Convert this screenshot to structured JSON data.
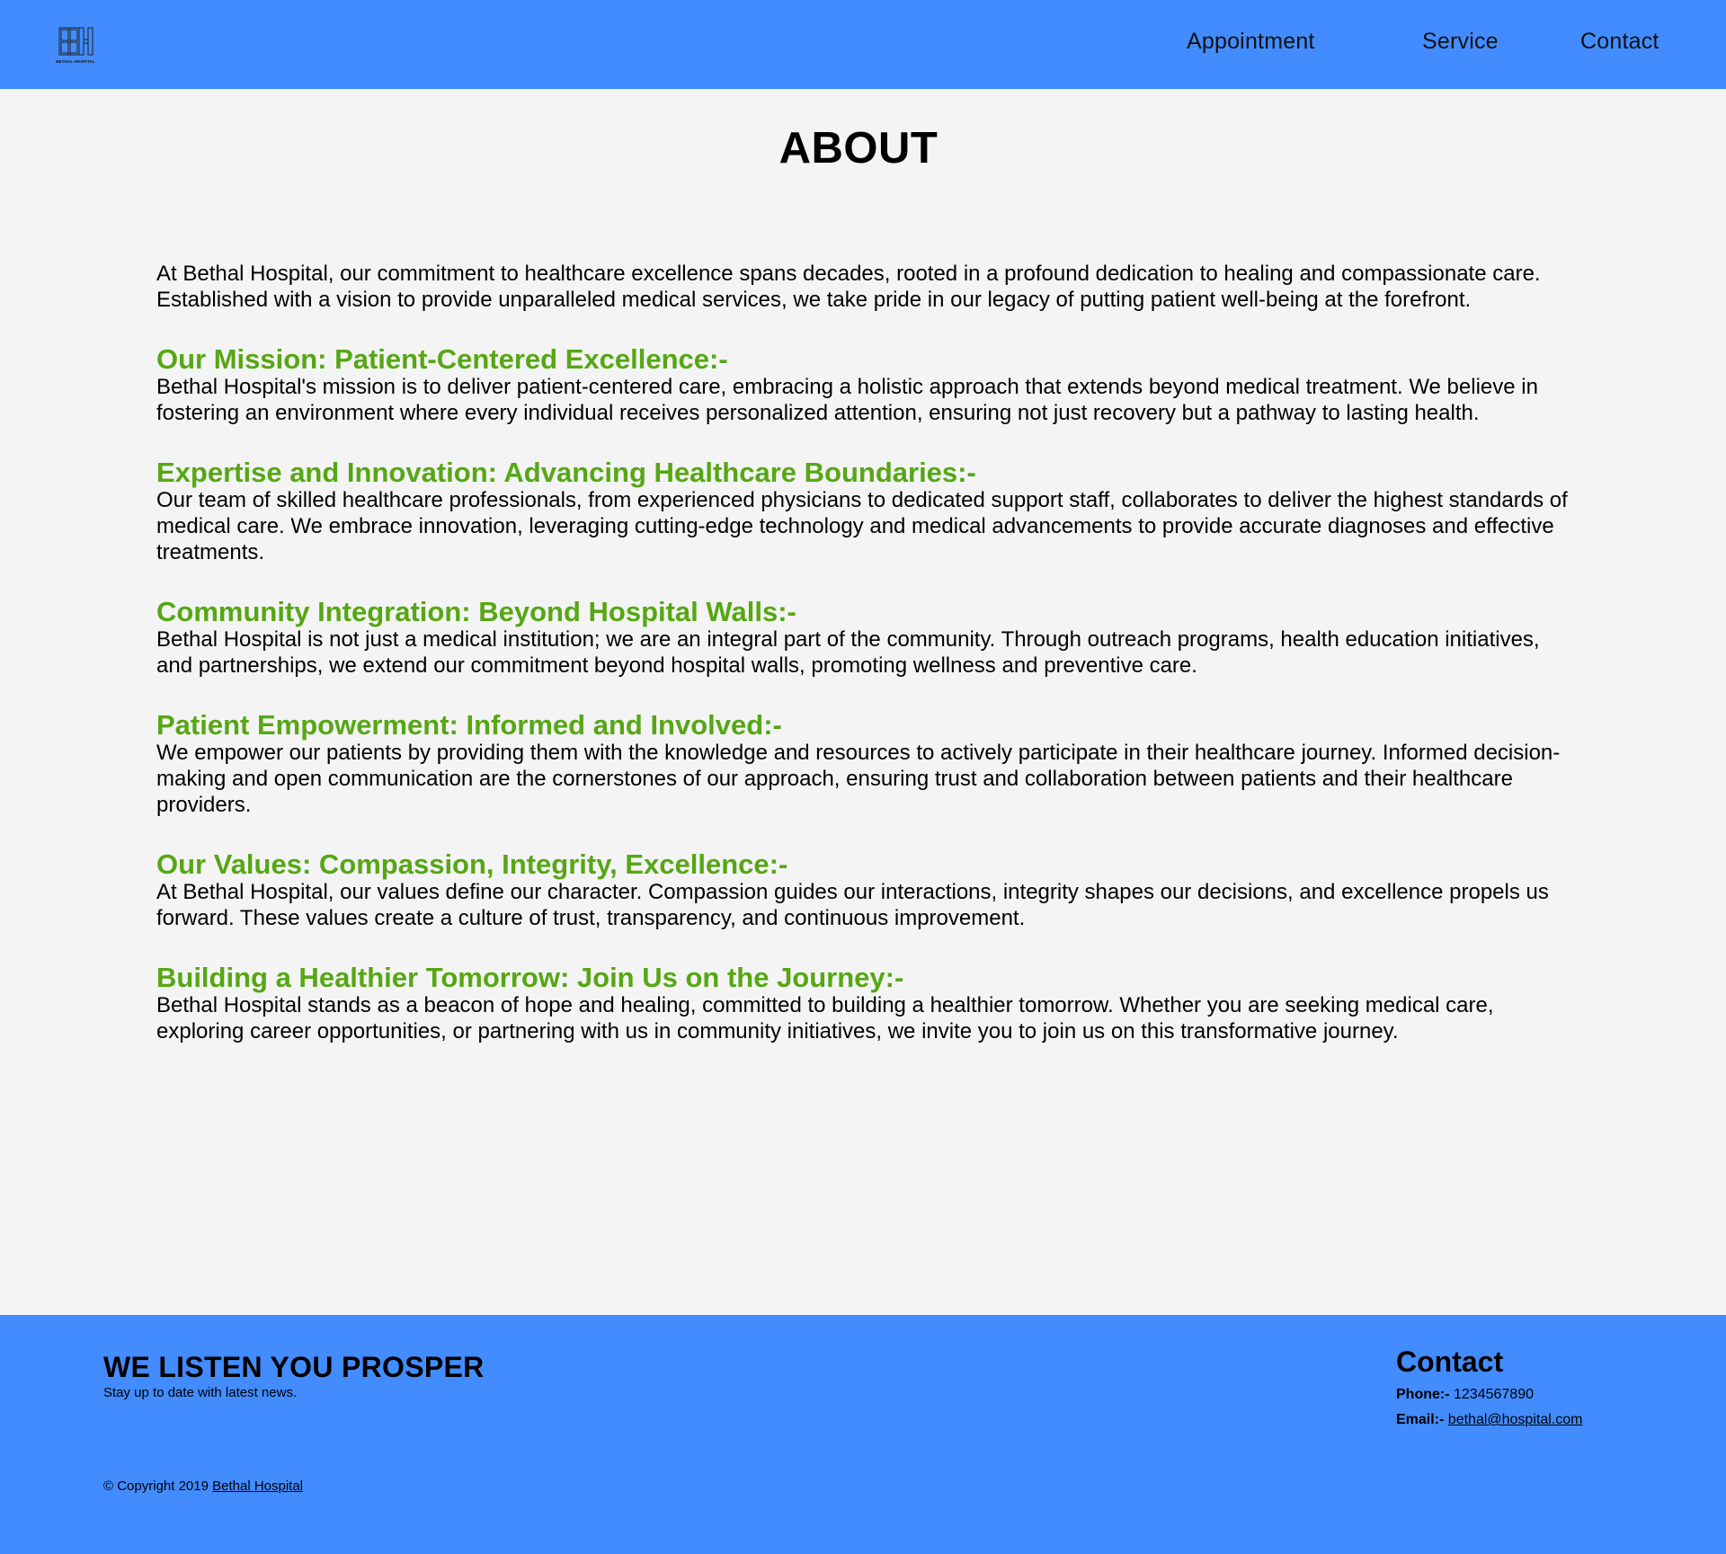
{
  "header": {
    "logo_text": "BETHAL HOSPITAL",
    "nav": [
      {
        "label": "Appointment"
      },
      {
        "label": "Service"
      },
      {
        "label": "Contact"
      }
    ],
    "background_color": "#428cff"
  },
  "main": {
    "title": "ABOUT",
    "intro": "At Bethal Hospital, our commitment to healthcare excellence spans decades, rooted in a profound dedication to healing and compassionate care. Established with a vision to provide unparalleled medical services, we take pride in our legacy of putting patient well-being at the forefront.",
    "heading_color": "#56a714",
    "sections": [
      {
        "title": "Our Mission: Patient-Centered Excellence:-",
        "body": "Bethal Hospital's mission is to deliver patient-centered care, embracing a holistic approach that extends beyond medical treatment. We believe in fostering an environment where every individual receives personalized attention, ensuring not just recovery but a pathway to lasting health."
      },
      {
        "title": "Expertise and Innovation: Advancing Healthcare Boundaries:-",
        "body": "Our team of skilled healthcare professionals, from experienced physicians to dedicated support staff, collaborates to deliver the highest standards of medical care. We embrace innovation, leveraging cutting-edge technology and medical advancements to provide accurate diagnoses and effective treatments."
      },
      {
        "title": "Community Integration: Beyond Hospital Walls:-",
        "body": "Bethal Hospital is not just a medical institution; we are an integral part of the community. Through outreach programs, health education initiatives, and partnerships, we extend our commitment beyond hospital walls, promoting wellness and preventive care."
      },
      {
        "title": "Patient Empowerment: Informed and Involved:-",
        "body": "We empower our patients by providing them with the knowledge and resources to actively participate in their healthcare journey. Informed decision-making and open communication are the cornerstones of our approach, ensuring trust and collaboration between patients and their healthcare providers."
      },
      {
        "title": "Our Values: Compassion, Integrity, Excellence:-",
        "body": "At Bethal Hospital, our values define our character. Compassion guides our interactions, integrity shapes our decisions, and excellence propels us forward. These values create a culture of trust, transparency, and continuous improvement."
      },
      {
        "title": "Building a Healthier Tomorrow: Join Us on the Journey:-",
        "body": "Bethal Hospital stands as a beacon of hope and healing, committed to building a healthier tomorrow. Whether you are seeking medical care, exploring career opportunities, or partnering with us in community initiatives, we invite you to join us on this transformative journey."
      }
    ]
  },
  "footer": {
    "tagline": "WE LISTEN YOU PROSPER",
    "subtitle": "Stay up to date with latest news.",
    "copyright_prefix": "© Copyright 2019",
    "copyright_link": "Bethal Hospital",
    "contact_heading": "Contact",
    "phone_label": "Phone:-",
    "phone": "1234567890",
    "email_label": "Email:-",
    "email": "bethal@hospital.com"
  }
}
